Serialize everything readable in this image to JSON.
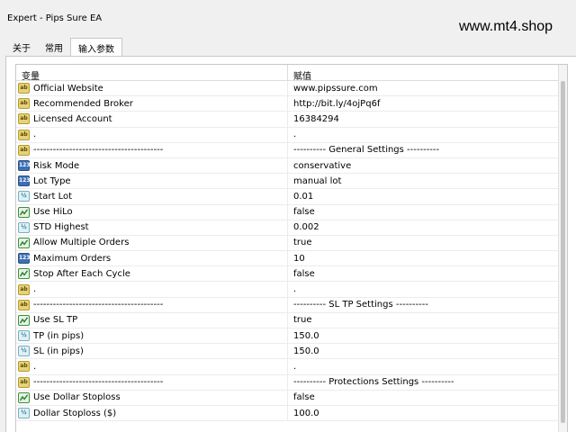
{
  "window": {
    "title": "Expert - Pips Sure EA",
    "watermark": "www.mt4.shop"
  },
  "tabs": [
    {
      "label": "关于"
    },
    {
      "label": "常用"
    },
    {
      "label": "输入参数",
      "active": true
    }
  ],
  "table": {
    "headers": {
      "variable": "变量",
      "value": "赋值"
    },
    "rows": [
      {
        "icon": "ab",
        "name": "Official Website",
        "value": "www.pipssure.com"
      },
      {
        "icon": "ab",
        "name": "Recommended Broker",
        "value": "http://bit.ly/4ojPq6f"
      },
      {
        "icon": "ab",
        "name": "Licensed Account",
        "value": "16384294"
      },
      {
        "icon": "ab",
        "name": ".",
        "value": "."
      },
      {
        "icon": "ab",
        "name": "----------------------------------------",
        "value": "----------  General Settings  ----------"
      },
      {
        "icon": "123",
        "name": "Risk Mode",
        "value": "conservative"
      },
      {
        "icon": "123",
        "name": "Lot Type",
        "value": "manual lot"
      },
      {
        "icon": "1/2",
        "name": "Start Lot",
        "value": "0.01"
      },
      {
        "icon": "bool",
        "name": "Use HiLo",
        "value": "false"
      },
      {
        "icon": "1/2",
        "name": "STD Highest",
        "value": "0.002"
      },
      {
        "icon": "bool",
        "name": "Allow Multiple Orders",
        "value": "true"
      },
      {
        "icon": "123",
        "name": "Maximum Orders",
        "value": "10"
      },
      {
        "icon": "bool",
        "name": "Stop After Each Cycle",
        "value": "false"
      },
      {
        "icon": "ab",
        "name": ".",
        "value": "."
      },
      {
        "icon": "ab",
        "name": "----------------------------------------",
        "value": "----------  SL TP Settings  ----------"
      },
      {
        "icon": "bool",
        "name": "Use SL TP",
        "value": "true"
      },
      {
        "icon": "1/2",
        "name": "TP (in pips)",
        "value": "150.0"
      },
      {
        "icon": "1/2",
        "name": "SL (in pips)",
        "value": "150.0"
      },
      {
        "icon": "ab",
        "name": ".",
        "value": "."
      },
      {
        "icon": "ab",
        "name": "----------------------------------------",
        "value": "----------  Protections Settings  ----------"
      },
      {
        "icon": "bool",
        "name": "Use Dollar Stoploss",
        "value": "false"
      },
      {
        "icon": "1/2",
        "name": "Dollar Stoploss ($)",
        "value": "100.0"
      }
    ]
  }
}
